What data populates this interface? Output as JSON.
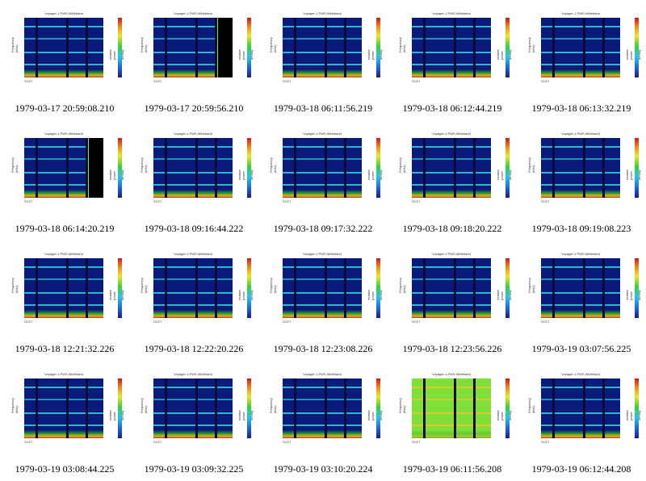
{
  "panels": [
    {
      "timestamp": "1979-03-17 20:59:08.210",
      "variant": "normal"
    },
    {
      "timestamp": "1979-03-17 20:59:56.210",
      "variant": "blacked_right"
    },
    {
      "timestamp": "1979-03-18 06:11:56.219",
      "variant": "normal"
    },
    {
      "timestamp": "1979-03-18 06:12:44.219",
      "variant": "normal"
    },
    {
      "timestamp": "1979-03-18 06:13:32.219",
      "variant": "normal"
    },
    {
      "timestamp": "1979-03-18 06:14:20.219",
      "variant": "blacked_right"
    },
    {
      "timestamp": "1979-03-18 09:16:44.222",
      "variant": "normal"
    },
    {
      "timestamp": "1979-03-18 09:17:32.222",
      "variant": "normal"
    },
    {
      "timestamp": "1979-03-18 09:18:20.222",
      "variant": "normal"
    },
    {
      "timestamp": "1979-03-18 09:19:08.223",
      "variant": "normal"
    },
    {
      "timestamp": "1979-03-18 12:21:32.226",
      "variant": "normal"
    },
    {
      "timestamp": "1979-03-18 12:22:20.226",
      "variant": "normal"
    },
    {
      "timestamp": "1979-03-18 12:23:08.226",
      "variant": "normal"
    },
    {
      "timestamp": "1979-03-18 12:23:56.226",
      "variant": "normal"
    },
    {
      "timestamp": "1979-03-19 03:07:56.225",
      "variant": "normal"
    },
    {
      "timestamp": "1979-03-19 03:08:44.225",
      "variant": "normal"
    },
    {
      "timestamp": "1979-03-19 03:09:32.225",
      "variant": "normal"
    },
    {
      "timestamp": "1979-03-19 03:10:20.224",
      "variant": "normal"
    },
    {
      "timestamp": "1979-03-19 06:11:56.208",
      "variant": "green"
    },
    {
      "timestamp": "1979-03-19 06:12:44.208",
      "variant": "normal"
    }
  ],
  "panel_text": {
    "title": "Voyager-1 PWS Wideband",
    "ylabel": "Frequency (kHz)",
    "colorbar_label": "relative power spectral density",
    "xtick_label": "SCET"
  },
  "colors": {
    "background": "#ffffff",
    "spectrogram_base": "#0a1a7a",
    "line": "#2fd6d6",
    "green_variant": "#7fe03a"
  }
}
